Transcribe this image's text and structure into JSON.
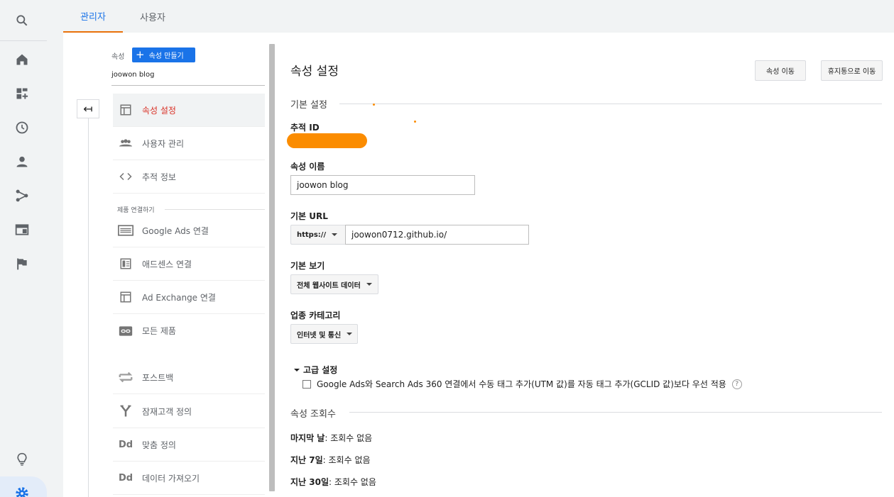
{
  "tabs": [
    {
      "label": "관리자",
      "active": true
    },
    {
      "label": "사용자",
      "active": false
    }
  ],
  "rail": {
    "icons": [
      "search-icon",
      "home-icon",
      "dashboard-add-icon",
      "clock-icon",
      "person-icon",
      "fork-icon",
      "display-icon",
      "flag-icon",
      "lightbulb-icon",
      "settings-icon"
    ]
  },
  "property": {
    "label": "속성",
    "create_button": "속성 만들기",
    "selected": "joowon blog"
  },
  "nav": {
    "items": [
      {
        "label": "속성 설정",
        "icon": "layout-icon",
        "active": true
      },
      {
        "label": "사용자 관리",
        "icon": "group-icon",
        "active": false
      },
      {
        "label": "추적 정보",
        "icon": "code-icon",
        "active": false
      }
    ],
    "section_label": "제품 연결하기",
    "product_items": [
      {
        "label": "Google Ads 연결",
        "icon": "ads-icon"
      },
      {
        "label": "애드센스 연결",
        "icon": "adsense-icon"
      },
      {
        "label": "Ad Exchange 연결",
        "icon": "layout-icon"
      },
      {
        "label": "모든 제품",
        "icon": "link-icon"
      }
    ],
    "other_items": [
      {
        "label": "포스트백",
        "icon": "swap-icon"
      },
      {
        "label": "잠재고객 정의",
        "icon": "fork-icon"
      },
      {
        "label": "맞춤 정의",
        "icon": "dd-icon"
      },
      {
        "label": "데이터 가져오기",
        "icon": "dd-icon"
      }
    ]
  },
  "main": {
    "title": "속성 설정",
    "move_button": "속성 이동",
    "trash_button": "휴지통으로 이동",
    "basic_section": "기본 설정",
    "tracking_id_label": "추적 ID",
    "property_name_label": "속성 이름",
    "property_name_value": "joowon blog",
    "default_url_label": "기본 URL",
    "protocol": "https://",
    "default_url_value": "joowon0712.github.io/",
    "default_view_label": "기본 보기",
    "default_view_value": "전체 웹사이트 데이터",
    "industry_label": "업종 카테고리",
    "industry_value": "인터넷 및 통신",
    "advanced_label": "고급 설정",
    "advanced_checkbox": "Google Ads와 Search Ads 360 연결에서 수동 태그 추가(UTM 값)를 자동 태그 추가(GCLID 값)보다 우선 적용",
    "hits_section": "속성 조회수",
    "hits": [
      {
        "period": "마지막 날",
        "value": ": 조회수 없음"
      },
      {
        "period": "지난 7일",
        "value": ": 조회수 없음"
      },
      {
        "period": "지난 30일",
        "value": ": 조회수 없음"
      }
    ]
  }
}
